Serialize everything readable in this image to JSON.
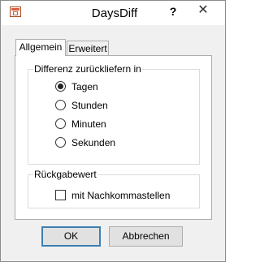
{
  "window": {
    "title": "DaysDiff",
    "help_label": "?",
    "close_label": "✕"
  },
  "tabs": [
    {
      "label": "Allgemein",
      "active": true
    },
    {
      "label": "Erweitert",
      "active": false
    }
  ],
  "difference_group": {
    "legend": "Differenz zurückliefern in",
    "options": [
      {
        "label": "Tagen",
        "selected": true
      },
      {
        "label": "Stunden",
        "selected": false
      },
      {
        "label": "Minuten",
        "selected": false
      },
      {
        "label": "Sekunden",
        "selected": false
      }
    ]
  },
  "return_group": {
    "legend": "Rückgabewert",
    "checkbox": {
      "label": "mit Nachkommastellen",
      "checked": false
    }
  },
  "buttons": {
    "ok_label": "OK",
    "cancel_label": "Abbrechen"
  },
  "icons": {
    "app": "app-window-icon",
    "help": "help-icon",
    "close": "close-icon"
  }
}
